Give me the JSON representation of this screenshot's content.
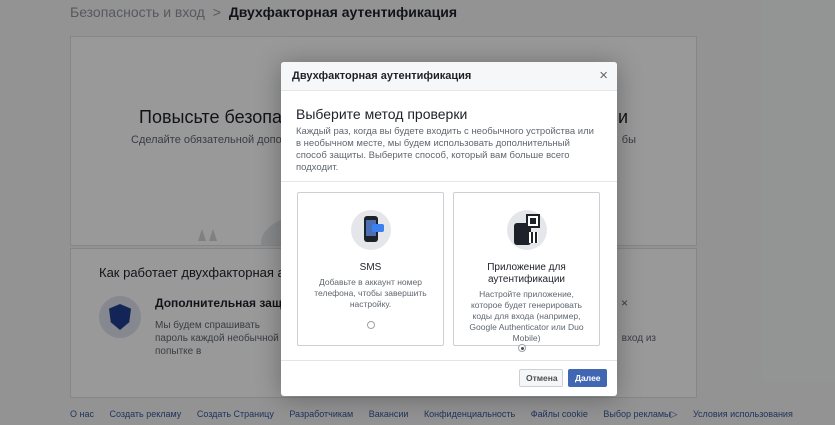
{
  "breadcrumb": {
    "parent": "Безопасность и вход",
    "separator": ">",
    "current": "Двухфакторная аутентификация"
  },
  "hero": {
    "title": "Повысьте безопасн",
    "title_right": "и",
    "subtitle": "Сделайте обязательной дополнит",
    "subtitle_right": "бы"
  },
  "how": {
    "title": "Как работает двухфакторная ауте",
    "extra_title": "Дополнительная защита",
    "extra_text": "Мы будем спрашивать пароль каждой необычной попытке в",
    "extra_text_right": "вход из"
  },
  "footer": {
    "links": [
      "О нас",
      "Создать рекламу",
      "Создать Страницу",
      "Разработчикам",
      "Вакансии",
      "Конфиденциальность",
      "Файлы cookie",
      "Выбор рекламы▷",
      "Условия использования"
    ]
  },
  "dialog": {
    "title": "Двухфакторная аутентификация",
    "close_glyph": "×",
    "method_title": "Выберите метод проверки",
    "method_desc": "Каждый раз, когда вы будете входить с необычного устройства или в необычном месте, мы будем использовать дополнительный способ защиты. Выберите способ, который вам больше всего подходит.",
    "options": [
      {
        "label": "SMS",
        "desc": "Добавьте в аккаунт номер телефона, чтобы завершить настройку.",
        "icon": "sms-phone-icon",
        "selected": false
      },
      {
        "label": "Приложение для аутентификации",
        "desc": "Настройте приложение, которое будет генерировать коды для входа (например, Google Authenticator или Duo Mobile)",
        "icon": "qr-code-phone-icon",
        "selected": true
      }
    ],
    "cancel_label": "Отмена",
    "next_label": "Далее"
  },
  "colors": {
    "primary": "#4267b2",
    "link": "#365899",
    "shield": "#1e3f8f"
  }
}
